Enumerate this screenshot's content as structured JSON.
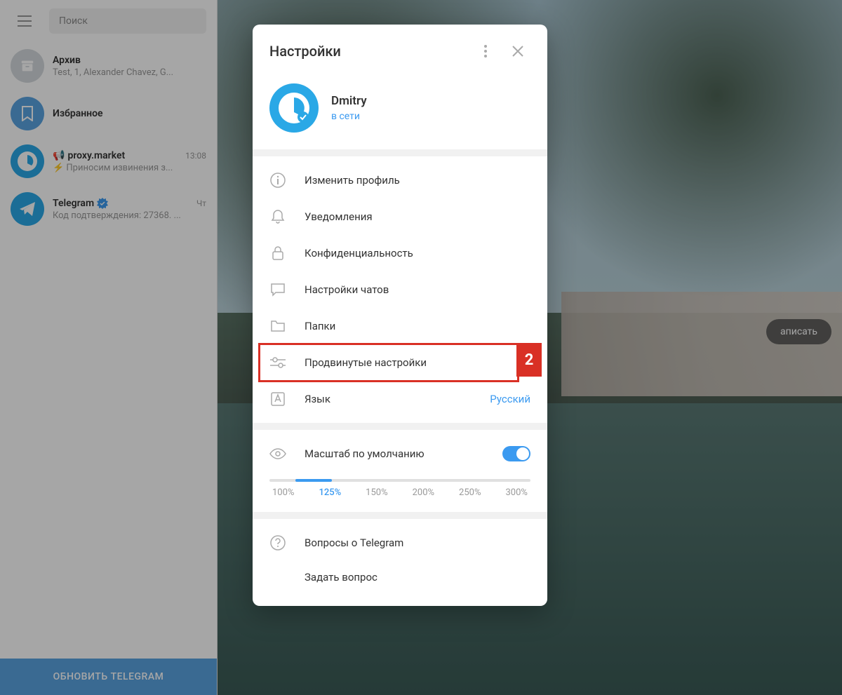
{
  "sidebar": {
    "search_placeholder": "Поиск",
    "chats": [
      {
        "title": "Архив",
        "preview": "Test, 1, Alexander Chavez, G...",
        "time": ""
      },
      {
        "title": "Избранное",
        "preview": "",
        "time": ""
      },
      {
        "title": "proxy.market",
        "preview": "⚡ Приносим извинения з...",
        "time": "13:08",
        "prefix": "📢"
      },
      {
        "title": "Telegram",
        "preview": "Код подтверждения: 27368. ...",
        "time": "Чт",
        "verified": true
      }
    ],
    "update_label": "ОБНОВИТЬ TELEGRAM"
  },
  "main": {
    "write_button": "аписать"
  },
  "modal": {
    "title": "Настройки",
    "profile": {
      "name": "Dmitry",
      "status": "в сети"
    },
    "items": [
      {
        "label": "Изменить профиль"
      },
      {
        "label": "Уведомления"
      },
      {
        "label": "Конфиденциальность"
      },
      {
        "label": "Настройки чатов"
      },
      {
        "label": "Папки"
      },
      {
        "label": "Продвинутые настройки",
        "highlighted": true,
        "badge": "2"
      },
      {
        "label": "Язык",
        "value": "Русский"
      }
    ],
    "scale": {
      "label": "Масштаб по умолчанию",
      "options": [
        "100%",
        "125%",
        "150%",
        "200%",
        "250%",
        "300%"
      ],
      "selected": "125%"
    },
    "help": {
      "faq": "Вопросы о Telegram",
      "ask": "Задать вопрос"
    }
  }
}
